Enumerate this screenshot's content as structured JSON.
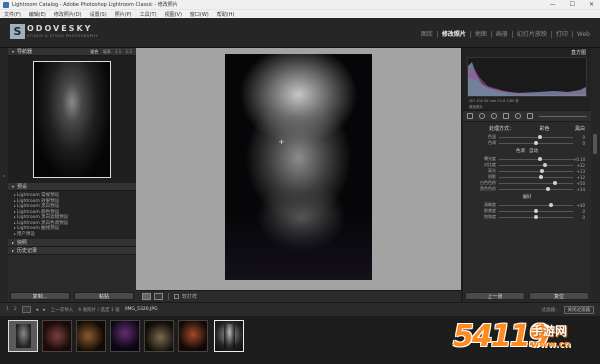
{
  "window": {
    "title": "Lightroom Catalog - Adobe Photoshop Lightroom Classic - 修改照片",
    "controls": [
      "—",
      "☐",
      "✕"
    ]
  },
  "menu": [
    "文件(F)",
    "编辑(E)",
    "修改照片(D)",
    "设置(S)",
    "照片(P)",
    "工具(T)",
    "视图(V)",
    "窗口(W)",
    "帮助(H)"
  ],
  "identity": {
    "logo_letter": "S",
    "logo_text": "ODOVESKY",
    "logo_sub": "STUDIO & STOCK PHOTOGRAPHY"
  },
  "modules": [
    {
      "label": "图库",
      "active": false
    },
    {
      "label": "修改照片",
      "active": true
    },
    {
      "label": "地图",
      "active": false
    },
    {
      "label": "画册",
      "active": false
    },
    {
      "label": "幻灯片放映",
      "active": false
    },
    {
      "label": "打印",
      "active": false
    },
    {
      "label": "Web",
      "active": false
    }
  ],
  "left_panel": {
    "navigator_label": "导航器",
    "navigator_options": [
      "适合",
      "填满",
      "1:1",
      "1:2"
    ],
    "presets_label": "预设",
    "presets": [
      "Lightroom 常规预设",
      "Lightroom 效果预设",
      "Lightroom 黑白预设",
      "Lightroom 颜色预设",
      "Lightroom 黑白滤镜预设",
      "Lightroom 黑白色调预设",
      "Lightroom 曲线预设",
      "用户预设"
    ],
    "snapshots_label": "快照",
    "history_label": "历史记录",
    "copy_button": "复制...",
    "paste_button": "粘贴"
  },
  "toolbar": {
    "softproof_label": "软打样"
  },
  "right_panel": {
    "histogram_label": "直方图",
    "histogram_meta": "ISO 100   50 mm   f/1.8   1/60 秒",
    "original_label": "原始照片",
    "basic": {
      "treatment_label": "处理方式：",
      "color_label": "彩色",
      "bw_label": "黑白",
      "sliders_wb": [
        {
          "label": "色温",
          "value": "0",
          "pos": 0.55
        },
        {
          "label": "色调",
          "value": "0",
          "pos": 0.5
        }
      ],
      "tone_label": "色调",
      "tone_auto": "自动",
      "sliders_tone": [
        {
          "label": "曝光度",
          "value": "+0.10",
          "pos": 0.55
        },
        {
          "label": "对比度",
          "value": "+32",
          "pos": 0.62
        },
        {
          "label": "高光",
          "value": "+13",
          "pos": 0.58
        },
        {
          "label": "阴影",
          "value": "+12",
          "pos": 0.57
        },
        {
          "label": "白色色阶",
          "value": "+50",
          "pos": 0.75
        },
        {
          "label": "黑色色阶",
          "value": "+34",
          "pos": 0.66
        }
      ],
      "presence_label": "偏好",
      "sliders_presence": [
        {
          "label": "清晰度",
          "value": "+40",
          "pos": 0.7
        },
        {
          "label": "鲜艳度",
          "value": "0",
          "pos": 0.5
        },
        {
          "label": "饱和度",
          "value": "0",
          "pos": 0.5
        }
      ]
    },
    "prev_button": "上一张",
    "reset_button": "复位"
  },
  "filmbar": {
    "page_1": "1",
    "page_2": "2",
    "source_label": "上一次导入",
    "count_text": "6 张照片 / 选定 1 张",
    "filename": "/IMG_5320.JPG",
    "filter_label": "过滤器：",
    "filter_value": "关闭过滤器"
  },
  "watermark": {
    "number": "54119",
    "brand_cn": "手游网",
    "brand_url": "www.cn"
  }
}
